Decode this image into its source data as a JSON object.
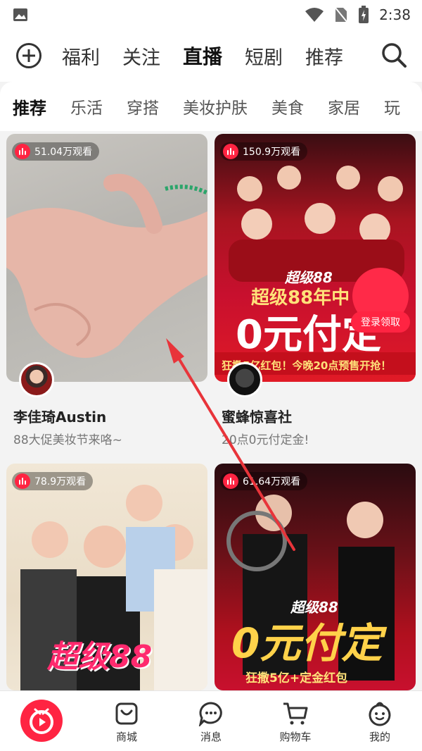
{
  "status": {
    "time": "2:38"
  },
  "top_tabs": [
    {
      "label": "福利",
      "active": false
    },
    {
      "label": "关注",
      "active": false
    },
    {
      "label": "直播",
      "active": true
    },
    {
      "label": "短剧",
      "active": false
    },
    {
      "label": "推荐",
      "active": false
    }
  ],
  "categories": [
    {
      "label": "推荐",
      "active": true
    },
    {
      "label": "乐活",
      "active": false
    },
    {
      "label": "穿搭",
      "active": false
    },
    {
      "label": "美妆护肤",
      "active": false
    },
    {
      "label": "美食",
      "active": false
    },
    {
      "label": "家居",
      "active": false
    },
    {
      "label": "玩",
      "active": false
    }
  ],
  "cards": [
    {
      "views": "51.04万观看",
      "name": "李佳琦Austin",
      "desc": "88大促美妆节来咯~"
    },
    {
      "views": "150.9万观看",
      "name": "蜜蜂惊喜社",
      "desc": "20点0元付定金!",
      "overlay": {
        "badge_small": "超级88",
        "title_line": "超级88年中",
        "big": "0元付定",
        "strip": "狂撒5亿红包！今晚20点预售开抢！",
        "redpacket": "登录领取"
      }
    },
    {
      "views": "78.9万观看",
      "overlay": {
        "big": "超级88"
      }
    },
    {
      "views": "61.64万观看",
      "overlay": {
        "badge_small": "超级88",
        "big": "0元付定",
        "strip": "狂撒5亿+定金红包"
      }
    }
  ],
  "bottom_nav": [
    {
      "label": "商城",
      "icon": "shop-bag-icon"
    },
    {
      "label": "消息",
      "icon": "message-icon"
    },
    {
      "label": "购物车",
      "icon": "cart-icon"
    },
    {
      "label": "我的",
      "icon": "profile-face-icon"
    }
  ],
  "colors": {
    "accent": "#ff2442",
    "card_red": "#c8102e",
    "gold": "#ffd24a"
  }
}
